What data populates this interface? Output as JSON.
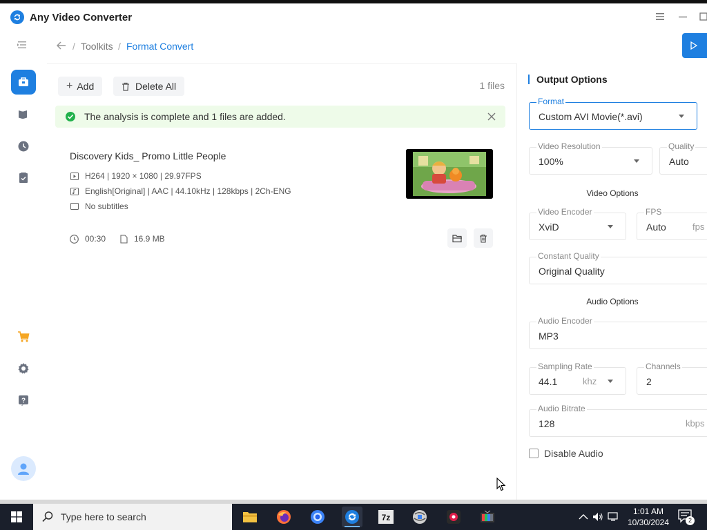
{
  "app": {
    "title": "Any Video Converter"
  },
  "breadcrumb": {
    "parent": "Toolkits",
    "current": "Format Convert"
  },
  "toolbar": {
    "add_label": "Add",
    "delete_all_label": "Delete All",
    "file_count": "1 files"
  },
  "alert": {
    "message": "The analysis is complete and 1 files are added."
  },
  "file": {
    "title": "Discovery Kids_ Promo Little People",
    "video_info": "H264 | 1920 × 1080 | 29.97FPS",
    "audio_info": "English[Original] | AAC | 44.10kHz | 128kbps | 2Ch-ENG",
    "subtitle_info": "No subtitles",
    "duration": "00:30",
    "size": "16.9 MB"
  },
  "output": {
    "title": "Output Options",
    "format": {
      "label": "Format",
      "value": "Custom AVI Movie(*.avi)"
    },
    "video_resolution": {
      "label": "Video Resolution",
      "value": "100%"
    },
    "quality": {
      "label": "Quality",
      "value": "Auto"
    },
    "video_section": "Video Options",
    "video_encoder": {
      "label": "Video Encoder",
      "value": "XviD"
    },
    "fps": {
      "label": "FPS",
      "value": "Auto",
      "unit": "fps"
    },
    "constant_quality": {
      "label": "Constant Quality",
      "value": "Original Quality"
    },
    "audio_section": "Audio Options",
    "audio_encoder": {
      "label": "Audio Encoder",
      "value": "MP3"
    },
    "sampling_rate": {
      "label": "Sampling Rate",
      "value": "44.1",
      "unit": "khz"
    },
    "channels": {
      "label": "Channels",
      "value": "2"
    },
    "audio_bitrate": {
      "label": "Audio Bitrate",
      "value": "128",
      "unit": "kbps"
    },
    "disable_audio": {
      "label": "Disable Audio",
      "checked": false
    }
  },
  "taskbar": {
    "search_placeholder": "Type here to search",
    "time": "1:01 AM",
    "date": "10/30/2024",
    "notification_count": "2"
  },
  "colors": {
    "accent": "#1e7fe0",
    "success": "#22b14c",
    "alert_bg": "#eefbe9",
    "taskbar": "#1a1f2b"
  }
}
